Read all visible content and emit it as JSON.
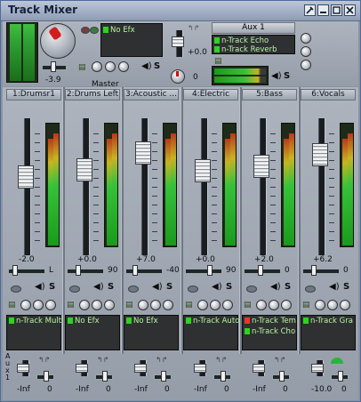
{
  "window": {
    "title": "Track Mixer",
    "controls": [
      "✕",
      "▭",
      "□",
      "✕"
    ]
  },
  "master": {
    "label": "Master",
    "value": "-3.9",
    "fx_label": "No Efx"
  },
  "aux": {
    "name": "Aux 1",
    "effects": [
      "n-Track Echo",
      "n-Track Reverb"
    ],
    "level": "+0.0",
    "pan_value": "0"
  },
  "channels": [
    {
      "name": "1:Drumsr1",
      "level": "-2.0",
      "pan": "L",
      "fx": [
        "n-Track Multi"
      ],
      "fx_red": [],
      "send": "-Inf",
      "send_pan": "0"
    },
    {
      "name": "2:Drums Left",
      "level": "+0.0",
      "pan": "90",
      "fx": [
        "No Efx"
      ],
      "fx_red": [],
      "send": "-Inf",
      "send_pan": "0"
    },
    {
      "name": "3:Acoustic ...",
      "level": "+7.0",
      "pan": "-40",
      "fx": [
        "No Efx"
      ],
      "fx_red": [],
      "send": "-Inf",
      "send_pan": "0"
    },
    {
      "name": "4:Electric",
      "level": "+0.0",
      "pan": "90",
      "fx": [
        "n-Track Auto"
      ],
      "fx_red": [],
      "send": "-Inf",
      "send_pan": "0"
    },
    {
      "name": "5:Bass",
      "level": "+2.0",
      "pan": "0",
      "fx": [
        "n-Track Tem",
        "n-Track Cho"
      ],
      "fx_red": [
        true,
        false
      ],
      "send": "-Inf",
      "send_pan": "0"
    },
    {
      "name": "6:Vocals",
      "level": "+6.2",
      "pan": "0",
      "fx": [
        "n-Track Gra"
      ],
      "fx_red": [],
      "send": "-10.0",
      "send_pan": "0"
    }
  ],
  "aux_send_label": "Aux 1",
  "icons": {
    "speaker": "speaker-icon",
    "solo": "solo-icon",
    "fx_toggle": "fx-icon"
  }
}
